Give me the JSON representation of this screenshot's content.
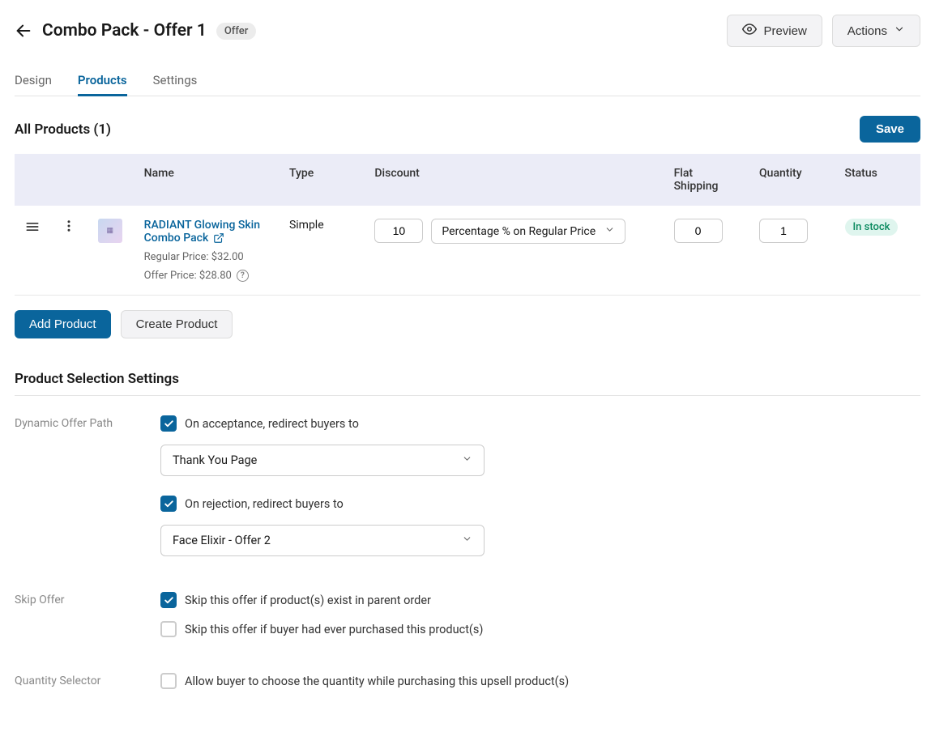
{
  "header": {
    "title": "Combo Pack - Offer 1",
    "badge": "Offer",
    "preview_label": "Preview",
    "actions_label": "Actions"
  },
  "tabs": [
    "Design",
    "Products",
    "Settings"
  ],
  "active_tab": "Products",
  "products": {
    "section_title": "All Products (1)",
    "save_label": "Save",
    "columns": {
      "name": "Name",
      "type": "Type",
      "discount": "Discount",
      "flat_shipping": "Flat Shipping",
      "quantity": "Quantity",
      "status": "Status"
    },
    "rows": [
      {
        "name": "RADIANT Glowing Skin Combo Pack",
        "regular_price_label": "Regular Price: $32.00",
        "offer_price_label": "Offer Price: $28.80",
        "type": "Simple",
        "discount_value": "10",
        "discount_type": "Percentage % on Regular Price",
        "flat_shipping": "0",
        "quantity": "1",
        "status": "In stock"
      }
    ],
    "add_product_label": "Add Product",
    "create_product_label": "Create Product"
  },
  "settings": {
    "section_title": "Product Selection Settings",
    "dynamic_offer_path": {
      "label": "Dynamic Offer Path",
      "on_acceptance": {
        "checked": true,
        "label": "On acceptance, redirect buyers to",
        "value": "Thank You Page"
      },
      "on_rejection": {
        "checked": true,
        "label": "On rejection, redirect buyers to",
        "value": "Face Elixir - Offer 2"
      }
    },
    "skip_offer": {
      "label": "Skip Offer",
      "parent_order": {
        "checked": true,
        "label": "Skip this offer if product(s) exist in parent order"
      },
      "purchased": {
        "checked": false,
        "label": "Skip this offer if buyer had ever purchased this product(s)"
      }
    },
    "quantity_selector": {
      "label": "Quantity Selector",
      "allow": {
        "checked": false,
        "label": "Allow buyer to choose the quantity while purchasing this upsell product(s)"
      }
    }
  }
}
